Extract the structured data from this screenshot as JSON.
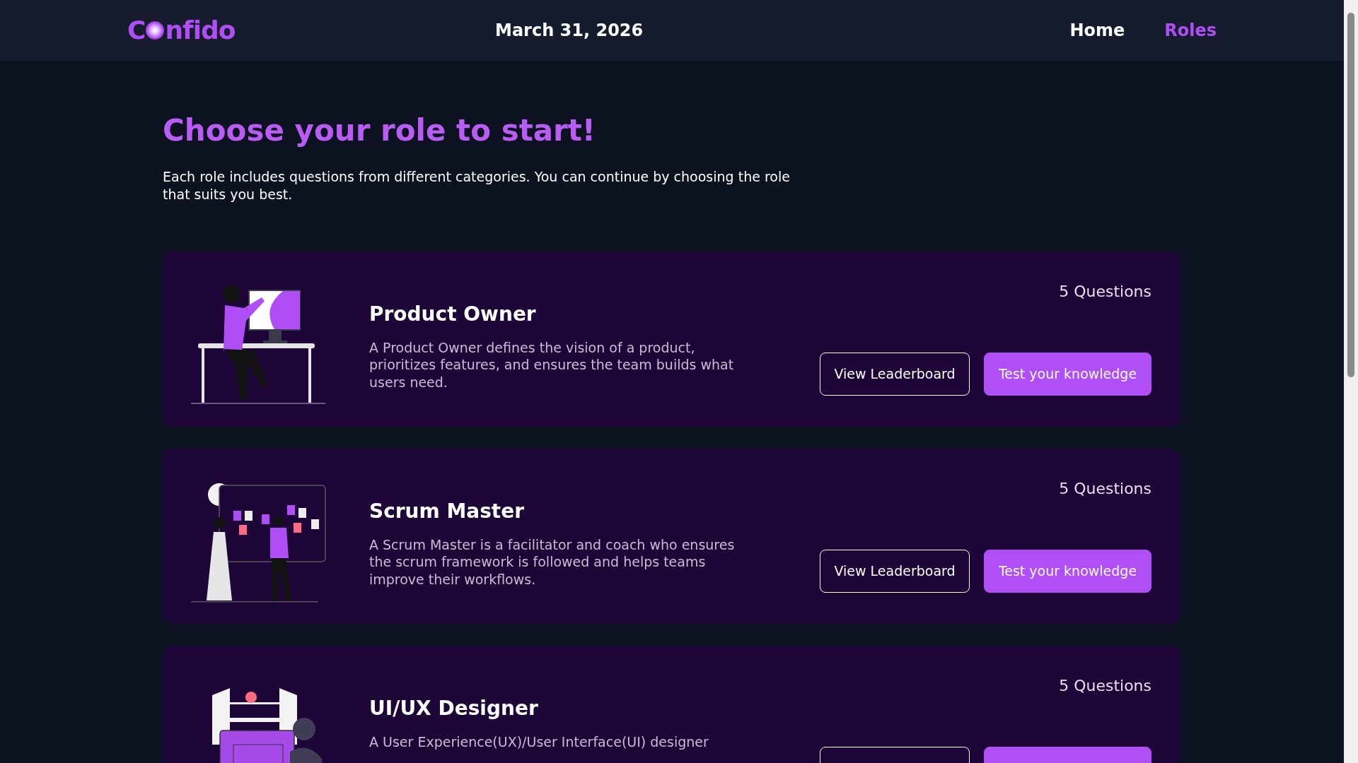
{
  "header": {
    "logo": {
      "before": "C",
      "after": "nfido"
    },
    "date": "March 31, 2026",
    "nav": [
      {
        "label": "Home",
        "selected": false
      },
      {
        "label": "Roles",
        "selected": true
      }
    ]
  },
  "title": "Choose your role to start!",
  "intro": "Each role includes questions from different categories. You can continue by choosing the role that suits you best.",
  "roles": [
    {
      "kind": "desk",
      "name": "Product Owner",
      "description": "A Product Owner defines the vision of a product, prioritizes features, and ensures the team builds what users need.",
      "questions": "5 Questions",
      "actions": [
        {
          "kind": "outline",
          "label": "View Leaderboard"
        },
        {
          "kind": "primary",
          "label": "Test your knowledge"
        }
      ]
    },
    {
      "kind": "board",
      "name": "Scrum Master",
      "description": "A Scrum Master is a facilitator and coach who ensures the scrum framework is followed and helps teams improve their workflows.",
      "questions": "5 Questions",
      "actions": [
        {
          "kind": "outline",
          "label": "View Leaderboard"
        },
        {
          "kind": "primary",
          "label": "Test your knowledge"
        }
      ]
    },
    {
      "kind": "designer",
      "name": "UI/UX Designer",
      "description": "A User Experience(UX)/User Interface(UI) designer",
      "questions": "5 Questions",
      "actions": [
        {
          "kind": "outline"
        },
        {
          "kind": "primary"
        }
      ]
    }
  ]
}
